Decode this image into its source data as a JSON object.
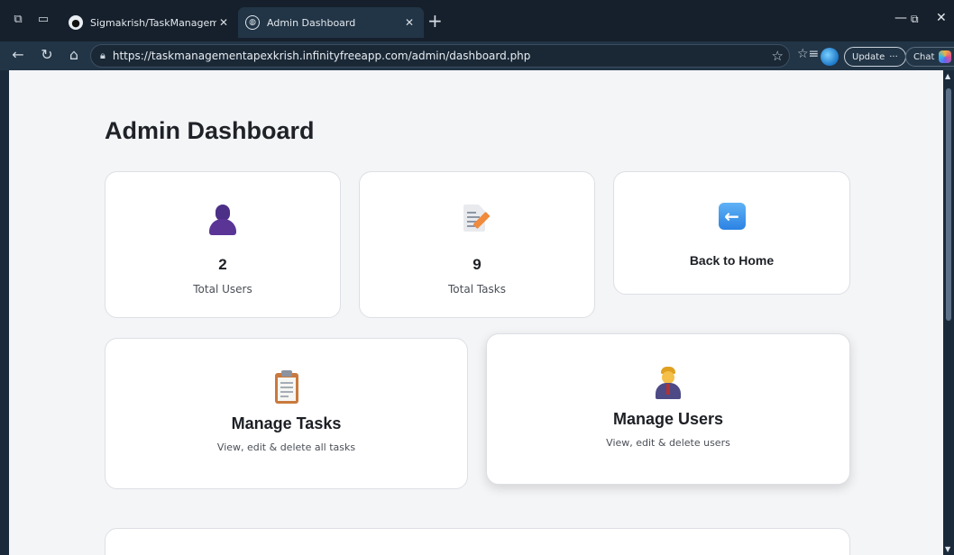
{
  "browser": {
    "tabs": [
      {
        "title": "Sigmakrish/TaskManagementSyste",
        "favicon": "github-icon"
      },
      {
        "title": "Admin Dashboard",
        "favicon": "globe-icon",
        "active": true
      }
    ],
    "url": "https://taskmanagementapexkrish.infinityfreeapp.com/admin/dashboard.php",
    "update_label": "Update",
    "chat_label": "Chat"
  },
  "page": {
    "title": "Admin Dashboard",
    "stats": [
      {
        "value": "2",
        "label": "Total Users",
        "icon": "user-silhouette-icon"
      },
      {
        "value": "9",
        "label": "Total Tasks",
        "icon": "document-pencil-icon"
      }
    ],
    "back_home": {
      "label": "Back to Home",
      "icon": "left-arrow-icon"
    },
    "manage_tasks": {
      "title": "Manage Tasks",
      "subtitle": "View, edit & delete all tasks",
      "icon": "clipboard-icon"
    },
    "manage_users": {
      "title": "Manage Users",
      "subtitle": "View, edit & delete users",
      "icon": "office-worker-icon"
    }
  },
  "colors": {
    "page_bg": "#f4f5f7",
    "card_bg": "#ffffff",
    "browser_chrome": "#16202c",
    "accent_blue": "#2b82e3"
  }
}
